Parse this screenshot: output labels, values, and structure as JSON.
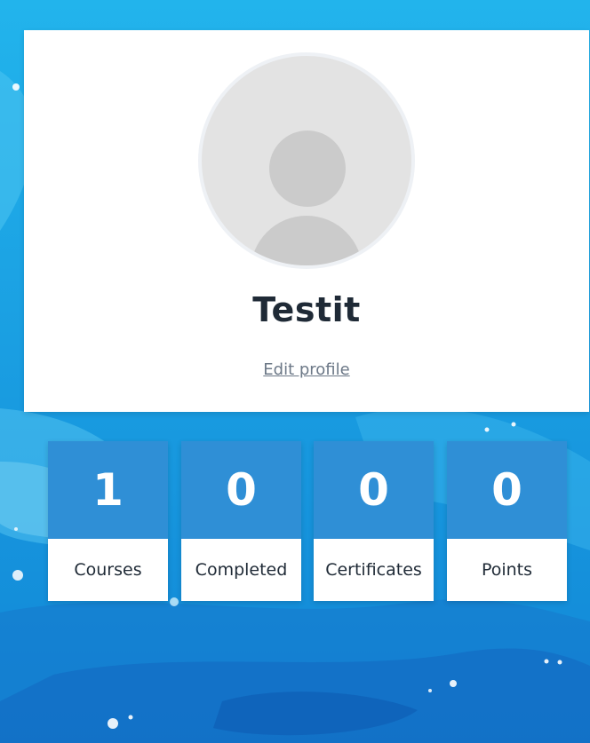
{
  "profile": {
    "name": "Testit",
    "edit_label": "Edit profile"
  },
  "stats": [
    {
      "value": "1",
      "label": "Courses"
    },
    {
      "value": "0",
      "label": "Completed"
    },
    {
      "value": "0",
      "label": "Certificates"
    },
    {
      "value": "0",
      "label": "Points"
    }
  ],
  "colors": {
    "background": "#1aa3e0",
    "tile_accent": "#2f8fd6",
    "card": "#ffffff",
    "text_dark": "#1f2a36",
    "link": "#6c7887"
  },
  "icons": {
    "avatar": "user-placeholder-icon"
  }
}
